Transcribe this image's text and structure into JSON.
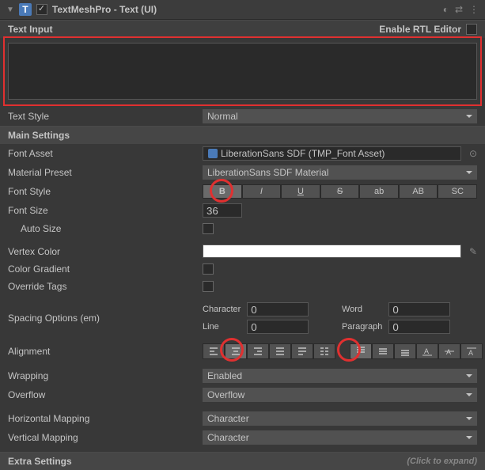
{
  "header": {
    "title": "TextMeshPro - Text (UI)",
    "enabled": true
  },
  "textInput": {
    "label": "Text Input",
    "rtlLabel": "Enable RTL Editor",
    "value": ""
  },
  "textStyle": {
    "label": "Text Style",
    "value": "Normal"
  },
  "mainSettings": {
    "label": "Main Settings",
    "fontAsset": {
      "label": "Font Asset",
      "value": "LiberationSans SDF (TMP_Font Asset)"
    },
    "materialPreset": {
      "label": "Material Preset",
      "value": "LiberationSans SDF Material"
    },
    "fontStyle": {
      "label": "Font Style",
      "buttons": [
        "B",
        "I",
        "U",
        "S",
        "ab",
        "AB",
        "SC"
      ]
    },
    "fontSize": {
      "label": "Font Size",
      "value": "36"
    },
    "autoSize": {
      "label": "Auto Size"
    },
    "vertexColor": {
      "label": "Vertex Color",
      "value": "#ffffff"
    },
    "colorGradient": {
      "label": "Color Gradient"
    },
    "overrideTags": {
      "label": "Override Tags"
    },
    "spacing": {
      "label": "Spacing Options (em)",
      "character": {
        "label": "Character",
        "value": "0"
      },
      "word": {
        "label": "Word",
        "value": "0"
      },
      "line": {
        "label": "Line",
        "value": "0"
      },
      "paragraph": {
        "label": "Paragraph",
        "value": "0"
      }
    },
    "alignment": {
      "label": "Alignment"
    },
    "wrapping": {
      "label": "Wrapping",
      "value": "Enabled"
    },
    "overflow": {
      "label": "Overflow",
      "value": "Overflow"
    },
    "hMapping": {
      "label": "Horizontal Mapping",
      "value": "Character"
    },
    "vMapping": {
      "label": "Vertical Mapping",
      "value": "Character"
    }
  },
  "extraSettings": {
    "label": "Extra Settings",
    "hint": "(Click to expand)"
  }
}
